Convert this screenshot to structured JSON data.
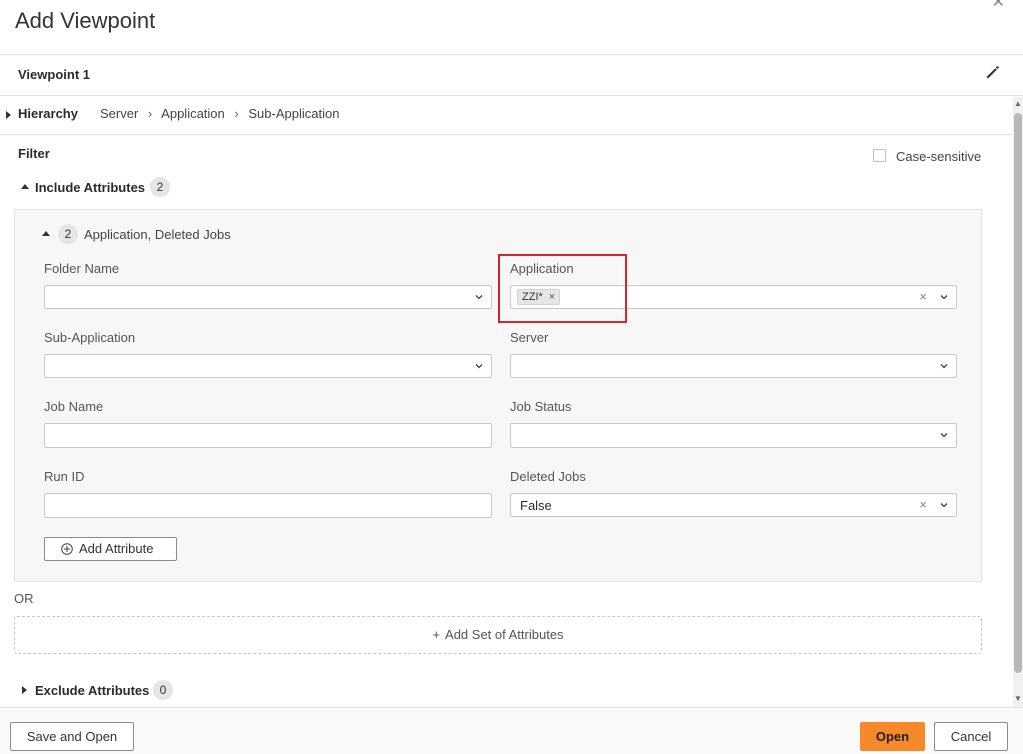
{
  "dialog": {
    "title": "Add Viewpoint",
    "viewpoint_name": "Viewpoint 1"
  },
  "hierarchy": {
    "label": "Hierarchy",
    "path": [
      "Server",
      "Application",
      "Sub-Application"
    ]
  },
  "filter": {
    "label": "Filter",
    "case_sensitive_label": "Case-sensitive",
    "case_sensitive_checked": false,
    "include": {
      "label": "Include Attributes",
      "count": "2",
      "set": {
        "count": "2",
        "summary": "Application, Deleted Jobs",
        "fields": {
          "folder_name": {
            "label": "Folder Name",
            "value": ""
          },
          "application": {
            "label": "Application",
            "tags": [
              "ZZI*"
            ]
          },
          "sub_application": {
            "label": "Sub-Application",
            "value": ""
          },
          "server": {
            "label": "Server",
            "value": ""
          },
          "job_name": {
            "label": "Job Name",
            "value": ""
          },
          "job_status": {
            "label": "Job Status",
            "value": ""
          },
          "run_id": {
            "label": "Run ID",
            "value": ""
          },
          "deleted_jobs": {
            "label": "Deleted Jobs",
            "value": "False"
          }
        },
        "add_attribute_label": "Add Attribute"
      }
    },
    "or_label": "OR",
    "add_set_label": "Add Set of Attributes",
    "exclude": {
      "label": "Exclude Attributes",
      "count": "0"
    }
  },
  "footer": {
    "save_and_open": "Save and Open",
    "open": "Open",
    "cancel": "Cancel"
  },
  "colors": {
    "primary": "#f7892a",
    "highlight": "#d0272d"
  }
}
